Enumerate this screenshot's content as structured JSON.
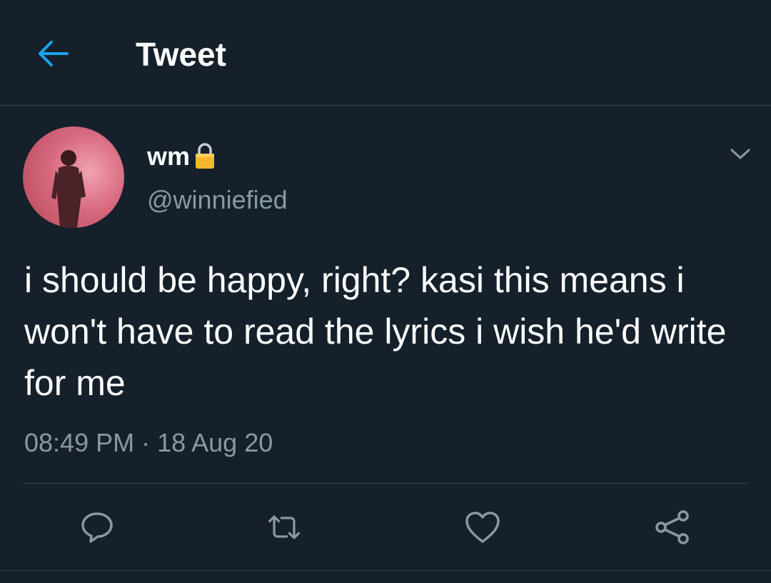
{
  "header": {
    "back_icon": "arrow-left-icon",
    "title": "Tweet"
  },
  "author": {
    "display_name": "wm",
    "protected_icon": "lock-icon",
    "handle": "@winniefied",
    "avatar_icon": "avatar-photo"
  },
  "tweet": {
    "text": "i should be happy, right? kasi this means i won't have to read the lyrics i wish he'd write for me",
    "time": "08:49 PM",
    "separator": "·",
    "date": "18 Aug 20"
  },
  "actions": {
    "reply_icon": "reply-icon",
    "retweet_icon": "retweet-icon",
    "like_icon": "heart-icon",
    "share_icon": "share-icon"
  },
  "colors": {
    "background": "#15202b",
    "accent": "#1da1f2",
    "secondary_text": "#8899a6",
    "border": "#38444d",
    "lock": "#f5b72b"
  }
}
